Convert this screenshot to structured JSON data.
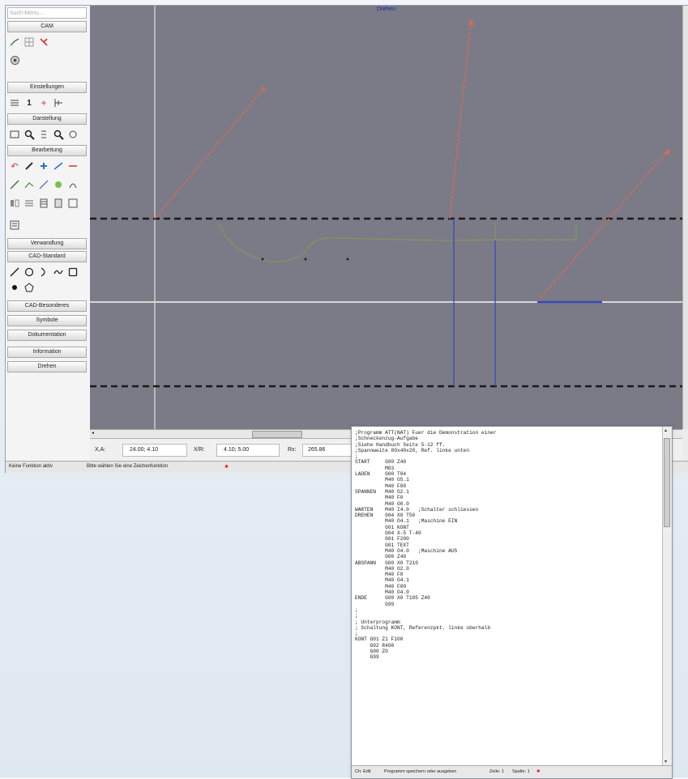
{
  "sidebar": {
    "search_placeholder": "Such-Menu...",
    "sections": [
      {
        "label": "CAM"
      },
      {
        "label": "Einstellungen"
      },
      {
        "label": "Darstellung"
      },
      {
        "label": "Bearbeitung"
      },
      {
        "label": "Verwandlung"
      },
      {
        "label": "CAD-Standard"
      },
      {
        "label": "CAD-Besonderes"
      },
      {
        "label": "Symbole"
      },
      {
        "label": "Dokumentation"
      },
      {
        "label": "Information"
      },
      {
        "label": "Drehen"
      }
    ]
  },
  "canvas": {
    "title": "Drehen",
    "background_color": "#7b7b87",
    "center_line_color": "#d8d8d8",
    "dashed_line_color": "#1a1a1a",
    "arrow_color": "#d26a5a",
    "contour_color": "#7fa34e",
    "tool_color": "#3a47b8"
  },
  "coordinates": {
    "xa_label": "X,A:",
    "xa_value": "24.00;  4.10",
    "xr_label": "X/R:",
    "xr_value": "4.10;  5.00",
    "rx_label": "Rx:",
    "rx_value": "265.86"
  },
  "status_bar": {
    "left": "Keine Funktion aktiv",
    "message": "Bitte wählen Sie eine Zeichenfunktion",
    "marker": "✱"
  },
  "editor": {
    "lines": [
      ";Programm ATT(NAT) Fuer die Demonstration einer",
      ";Schneckenzug-Aufgabe",
      ";Siehe Handbuch Seite 5-12 ff.",
      ";Spannweite 80x40x20, Ref. linke unten",
      ";",
      "START     G00 Z40",
      "          M03",
      "LADEN     G00 T04",
      "          M40 O5.1",
      "          M40 F00",
      "SPANNEN   M40 O2.1",
      "          M40 F0",
      "          M40 O0.0",
      "WARTEN    M40 I4.0   ;Schalter schliessen",
      "DREHEN    G04 X0 T50",
      "          M40 O4.1   ;Maschine EIN",
      "          G01 KONT",
      "          G04 X-5 T-40",
      "          G01 F200",
      "          G01 TEXT",
      "          M40 O4.0   ;Maschine AUS",
      "          G00 Z40",
      "ABSPANN   G00 X0 T210",
      "          M40 O2.0",
      "          M40 F0",
      "          M40 O4.1",
      "          M40 F00",
      "          M40 O4.0",
      "ENDE      G00 X0 T105 Z40",
      "          G99",
      ";",
      ";",
      "; Unterprogramm",
      "; Schaltung KONT, Referenzpkt. linke oberhalb",
      ";",
      "KONT G01 Z1 F100",
      "     G02 R400",
      "     G00 Z0",
      "     G99"
    ],
    "status": {
      "mode": "Ch: Edit",
      "message": "Programm speichern oder ausgeben",
      "zeile": "Zeile: 1",
      "spalte": "Spalte: 1",
      "marker": "✱"
    }
  }
}
